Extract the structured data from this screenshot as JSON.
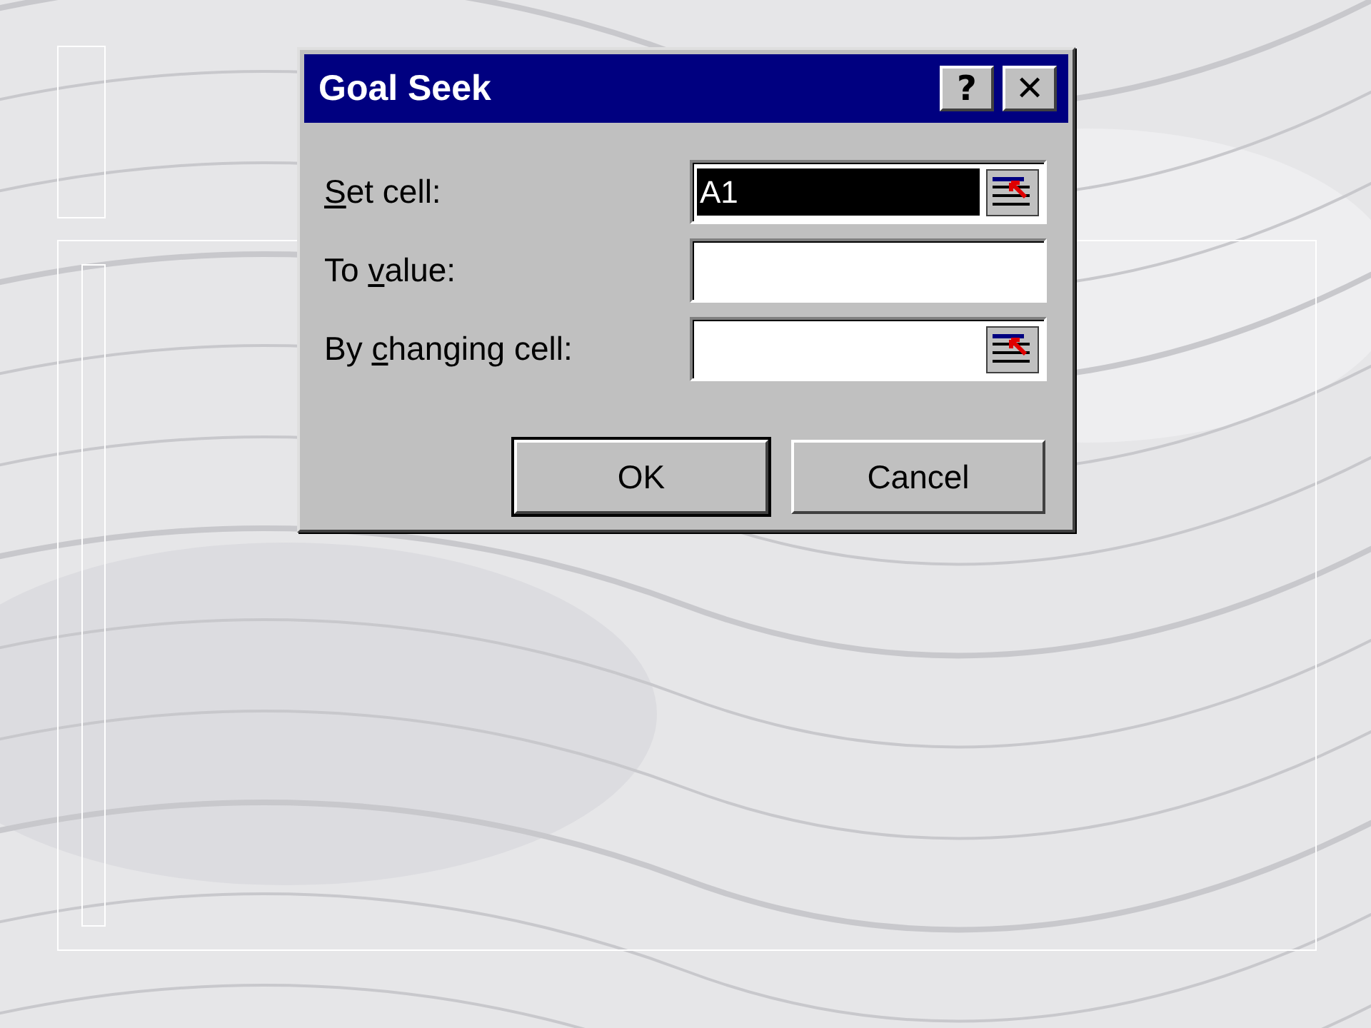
{
  "dialog": {
    "title": "Goal Seek",
    "title_buttons": [
      "?",
      "✕"
    ],
    "fields": [
      {
        "label": {
          "key": "S",
          "after": "et cell:"
        },
        "value": "A1",
        "selected": true,
        "has_picker": true
      },
      {
        "label": {
          "before": "To ",
          "key": "v",
          "after": "alue:"
        },
        "selected": false,
        "has_picker": false
      },
      {
        "label": {
          "before": "By ",
          "key": "c",
          "after": "hanging cell:"
        },
        "selected": false,
        "has_picker": true
      }
    ],
    "buttons": [
      {
        "label": "OK",
        "default": true
      },
      {
        "label": "Cancel",
        "default": false
      }
    ]
  }
}
